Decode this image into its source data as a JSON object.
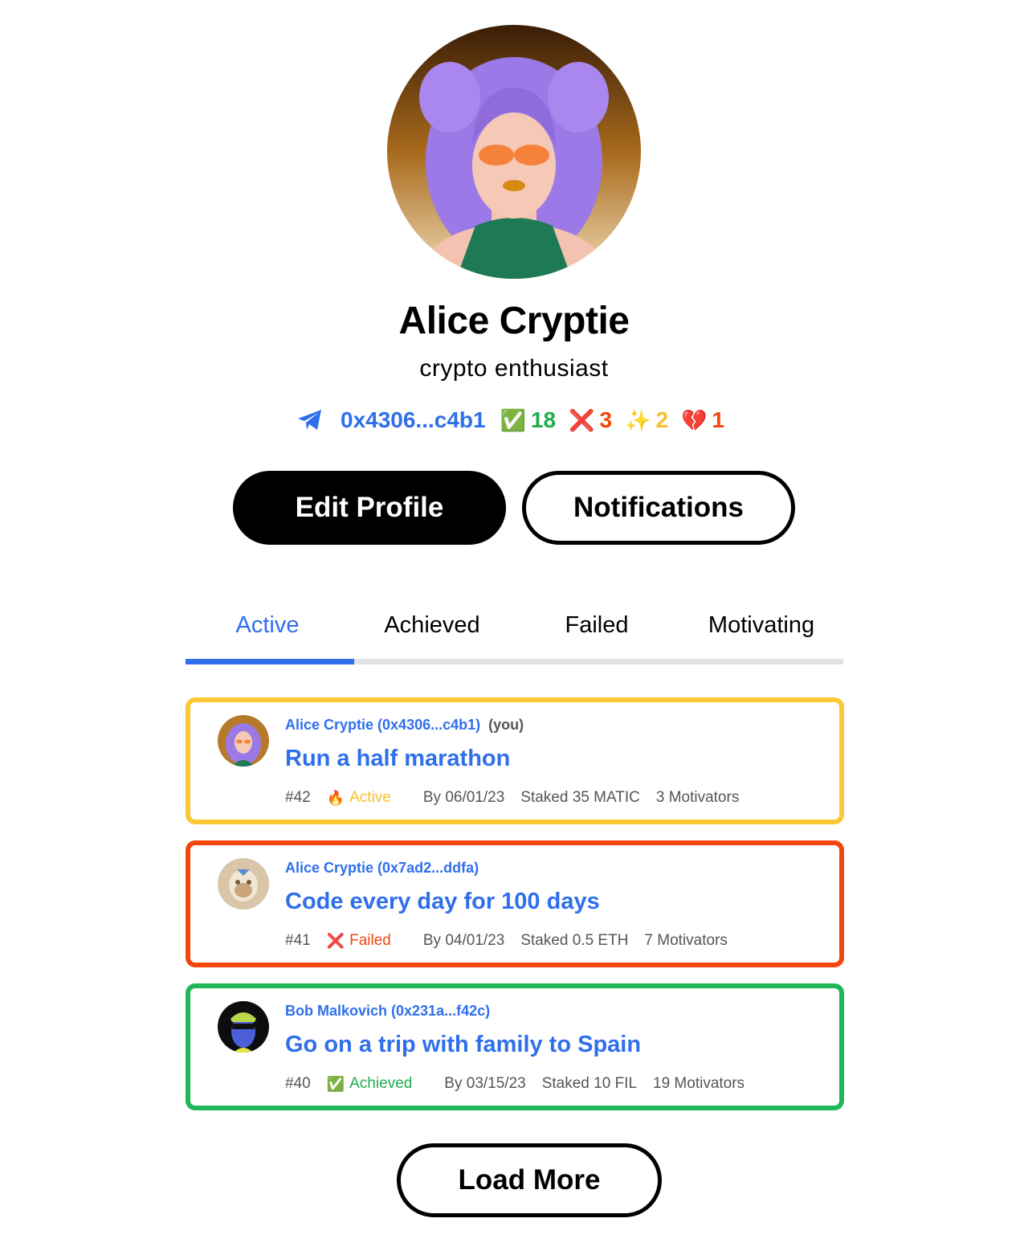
{
  "profile": {
    "name": "Alice Cryptie",
    "bio": "crypto enthusiast",
    "address": "0x4306...c4b1",
    "stats": [
      {
        "icon": "check-icon",
        "emoji": "✅",
        "value": "18",
        "color": "#1fad4e"
      },
      {
        "icon": "cross-icon",
        "emoji": "❌",
        "value": "3",
        "color": "#f2470c"
      },
      {
        "icon": "sparkles-icon",
        "emoji": "✨",
        "value": "2",
        "color": "#f7c02b"
      },
      {
        "icon": "broken-heart-icon",
        "emoji": "💔",
        "value": "1",
        "color": "#f2470c"
      }
    ]
  },
  "buttons": {
    "edit_profile": "Edit Profile",
    "notifications": "Notifications",
    "load_more": "Load More"
  },
  "tabs": [
    {
      "label": "Active",
      "selected": true
    },
    {
      "label": "Achieved",
      "selected": false
    },
    {
      "label": "Failed",
      "selected": false
    },
    {
      "label": "Motivating",
      "selected": false
    }
  ],
  "goals": [
    {
      "author": "Alice Cryptie (0x4306...c4b1)",
      "you_label": "(you)",
      "title": "Run a half marathon",
      "number": "#42",
      "status_emoji": "🔥",
      "status": "Active",
      "status_color": "#f7c02b",
      "border_color": "#fcc833",
      "deadline": "By 06/01/23",
      "stake": "Staked 35 MATIC",
      "motivators": "3 Motivators"
    },
    {
      "author": "Alice Cryptie (0x7ad2...ddfa)",
      "title": "Code every day for 100 days",
      "number": "#41",
      "status_emoji": "❌",
      "status": "Failed",
      "status_color": "#f2470c",
      "border_color": "#f2470c",
      "deadline": "By 04/01/23",
      "stake": "Staked 0.5 ETH",
      "motivators": "7 Motivators"
    },
    {
      "author": "Bob Malkovich (0x231a...f42c)",
      "title": "Go on a trip with family to Spain",
      "number": "#40",
      "status_emoji": "✅",
      "status": "Achieved",
      "status_color": "#1fad4e",
      "border_color": "#1fb757",
      "deadline": "By 03/15/23",
      "stake": "Staked 10 FIL",
      "motivators": "19 Motivators"
    }
  ],
  "colors": {
    "accent": "#2f6fec",
    "track": "#e2e2e2"
  }
}
